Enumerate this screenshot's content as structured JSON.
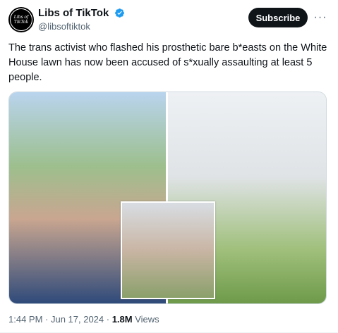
{
  "author": {
    "display_name": "Libs of TikTok",
    "handle": "@libsoftiktok",
    "avatar_text_line1": "Libs of",
    "avatar_text_line2": "TikTok",
    "verified": true
  },
  "actions": {
    "subscribe_label": "Subscribe",
    "more_icon": "more-horizontal-icon"
  },
  "post": {
    "text": "The trans activist who flashed his prosthetic bare b*easts on the White House lawn has now been accused of s*xually assaulting at least 5 people."
  },
  "media": {
    "count": 3
  },
  "meta": {
    "timestamp": "1:44 PM · Jun 17, 2024 · ",
    "views_count": "1.8M",
    "views_label": " Views"
  },
  "colors": {
    "text_primary": "#0f1419",
    "text_secondary": "#536471",
    "verified_badge": "#1d9bf0",
    "button_bg": "#0f1419"
  }
}
